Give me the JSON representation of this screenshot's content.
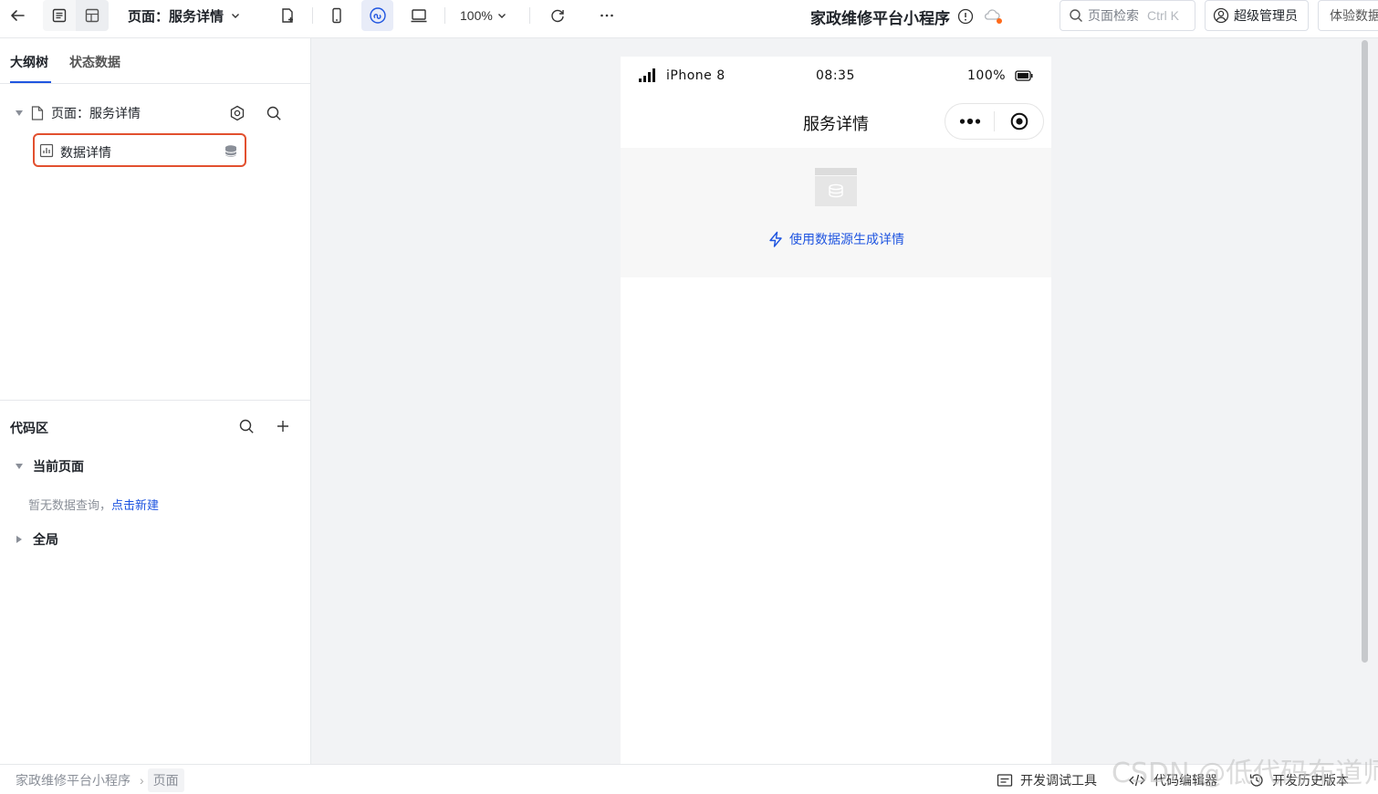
{
  "toolbar": {
    "page_selector_label": "页面：服务详情",
    "zoom_label": "100%",
    "app_title": "家政维修平台小程序",
    "search_label": "页面检索",
    "search_shortcut": "Ctrl K",
    "user_role_label": "超级管理员",
    "trial_data_label": "体验数据"
  },
  "left_panel": {
    "tabs": [
      {
        "label": "大纲树"
      },
      {
        "label": "状态数据"
      }
    ],
    "tree": {
      "page_node_label": "页面：服务详情",
      "child_node_label": "数据详情"
    },
    "code_area": {
      "title": "代码区",
      "current_page_label": "当前页面",
      "empty_text": "暂无数据查询，",
      "create_link": "点击新建",
      "global_label": "全局"
    }
  },
  "canvas": {
    "status_bar": {
      "device": "iPhone 8",
      "time": "08:35",
      "battery": "100%"
    },
    "nav_title": "服务详情",
    "generate_link": "使用数据源生成详情"
  },
  "bottom_bar": {
    "breadcrumb": [
      "家政维修平台小程序",
      "页面"
    ],
    "debug_tool_label": "开发调试工具",
    "code_editor_label": "代码编辑器",
    "history_label": "开发历史版本"
  },
  "watermark": "CSDN @低代码布道师",
  "colors": {
    "accent": "#1f55e0",
    "selection_border": "#e2502f"
  }
}
